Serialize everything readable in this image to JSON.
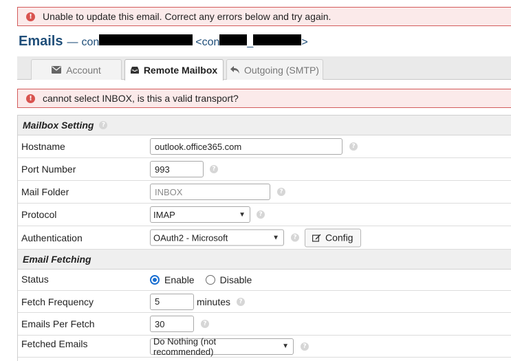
{
  "alerts": {
    "top": "Unable to update this email. Correct any errors below and try again.",
    "transport": "cannot select INBOX, is this a valid transport?",
    "icon": "!"
  },
  "heading": {
    "title": "Emails",
    "dash": "—",
    "name_start": "con",
    "email_open": "<con",
    "email_mid": "_",
    "email_close": ">"
  },
  "tabs": [
    {
      "label": "Account",
      "icon": "envelope-icon"
    },
    {
      "label": "Remote Mailbox",
      "icon": "inbox-icon",
      "active": true
    },
    {
      "label": "Outgoing (SMTP)",
      "icon": "reply-icon"
    }
  ],
  "mailbox_setting": {
    "title": "Mailbox Setting",
    "hostname": {
      "label": "Hostname",
      "value": "outlook.office365.com"
    },
    "port": {
      "label": "Port Number",
      "value": "993"
    },
    "folder": {
      "label": "Mail Folder",
      "placeholder": "INBOX"
    },
    "protocol": {
      "label": "Protocol",
      "value": "IMAP"
    },
    "authentication": {
      "label": "Authentication",
      "value": "OAuth2 - Microsoft",
      "config_button": "Config"
    }
  },
  "email_fetching": {
    "title": "Email Fetching",
    "status": {
      "label": "Status",
      "option_enable": "Enable",
      "option_disable": "Disable",
      "selected": "Enable"
    },
    "frequency": {
      "label": "Fetch Frequency",
      "value": "5",
      "unit": "minutes"
    },
    "per_fetch": {
      "label": "Emails Per Fetch",
      "value": "30"
    },
    "fetched": {
      "label": "Fetched Emails",
      "value": "Do Nothing (not recommended)"
    }
  },
  "help_glyph": "?",
  "colors": {
    "error_bg": "#fbeaea",
    "error_border": "#d35b5b",
    "error_icon": "#d9534f",
    "heading": "#1f4e79",
    "radio_accent": "#1a6fd1"
  }
}
